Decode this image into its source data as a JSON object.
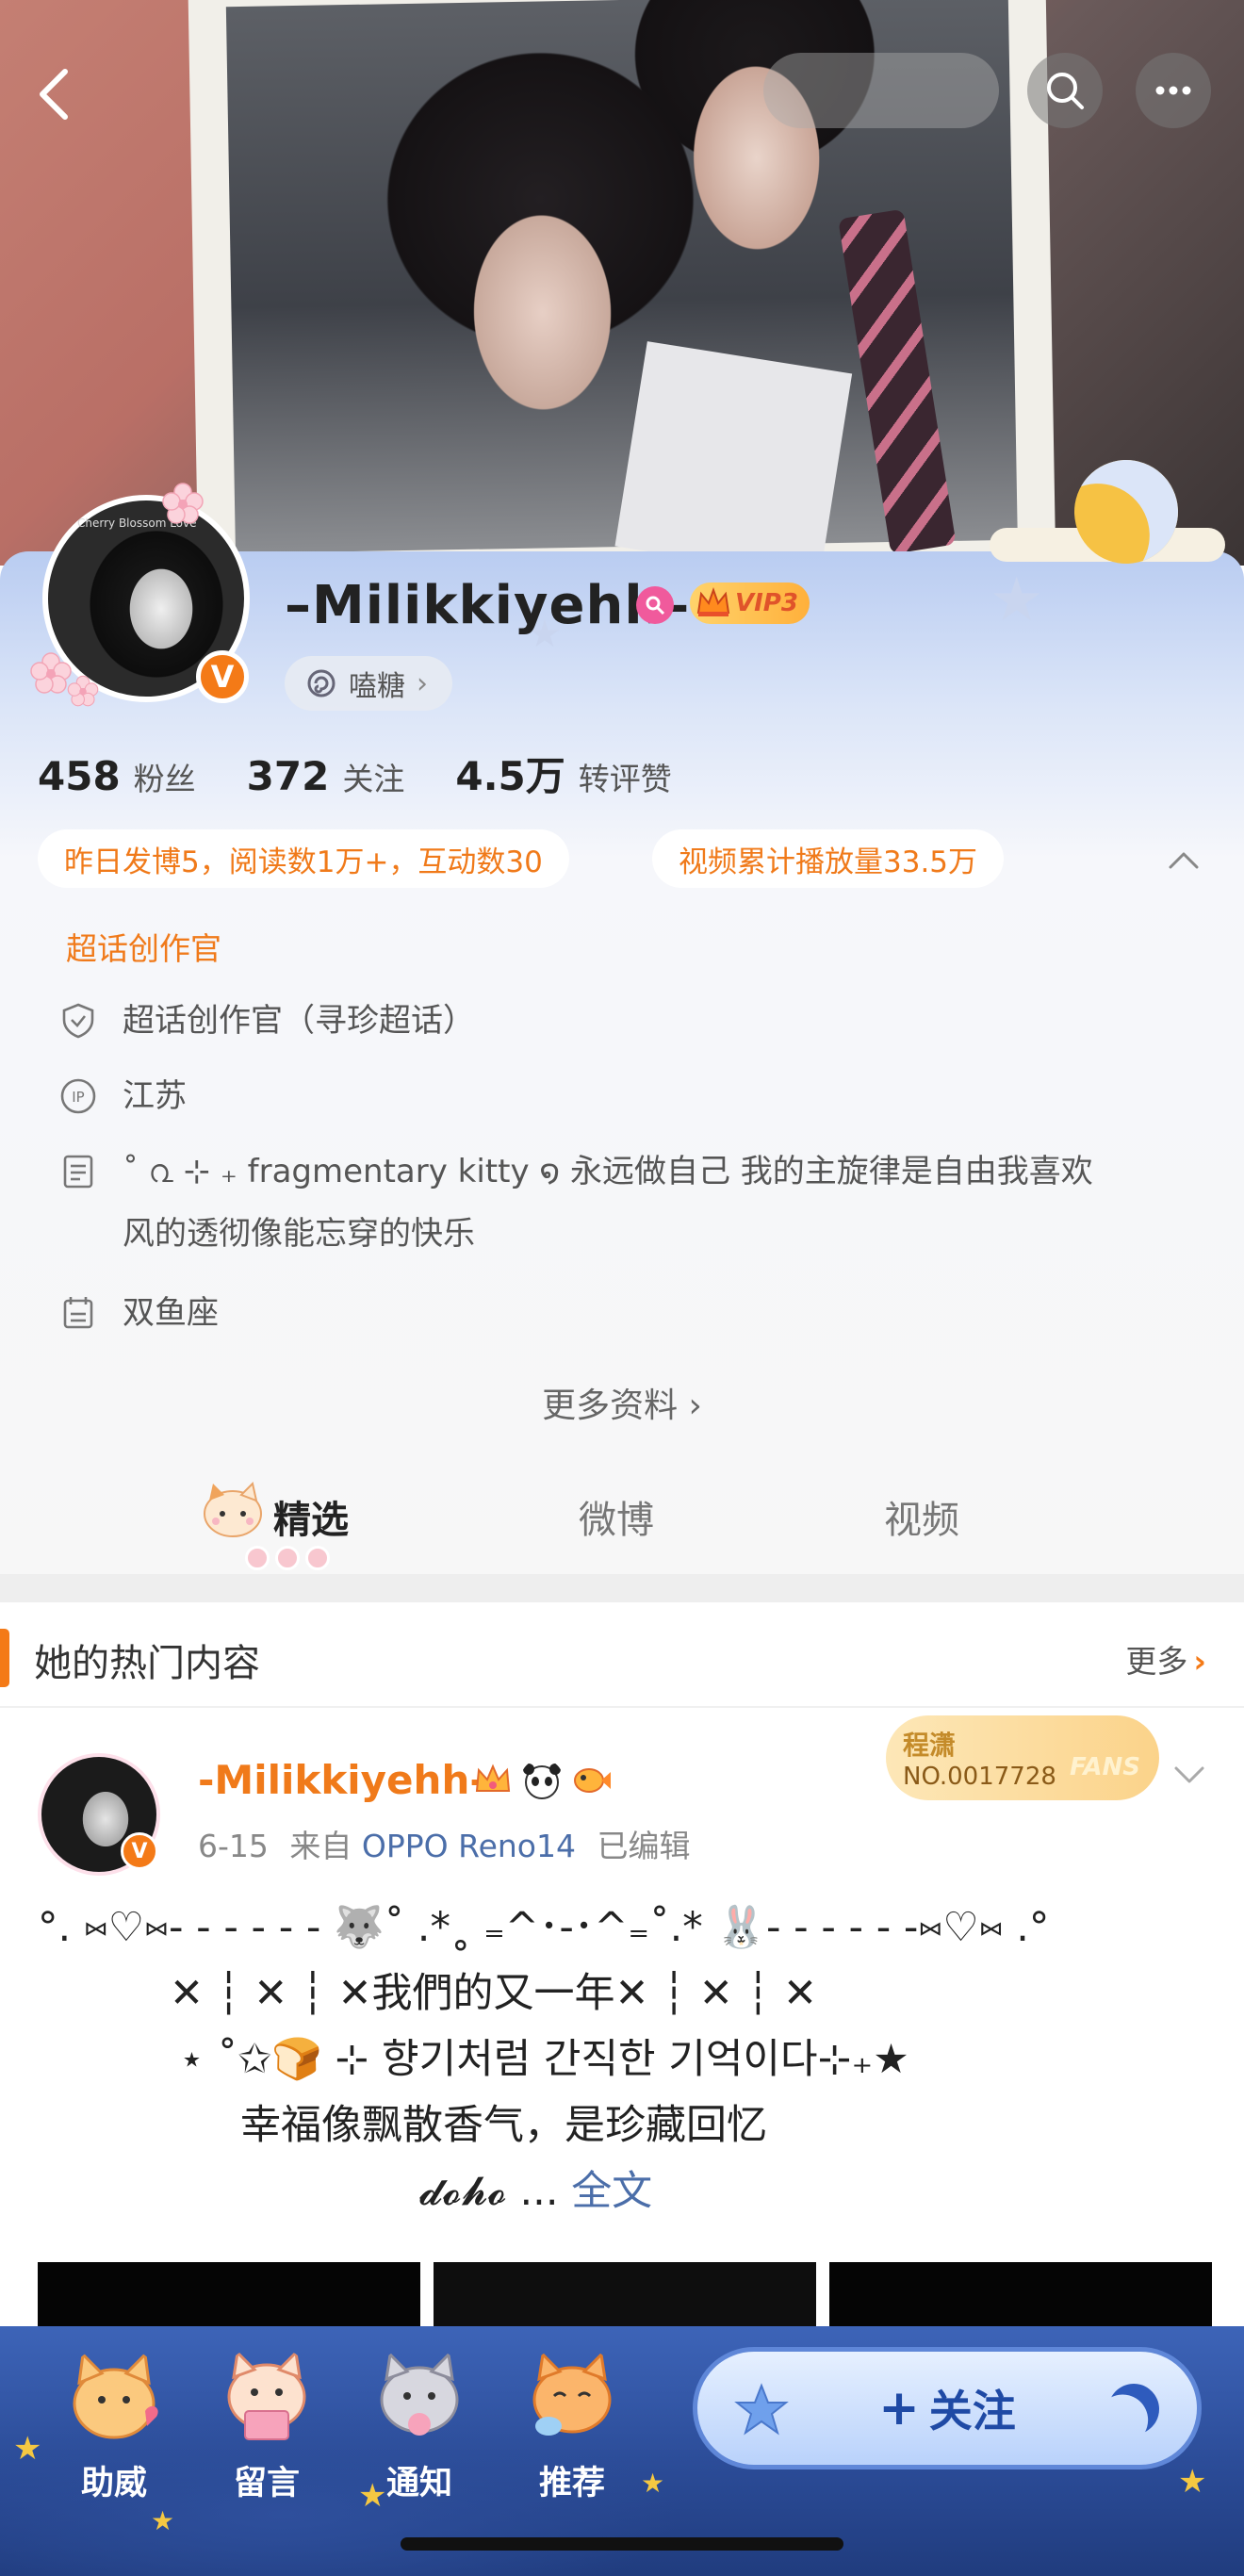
{
  "profile": {
    "username": "–Milikkiyehh–",
    "vip": "VIP3",
    "candy_label": "嗑糖",
    "avatar_caption": "Cherry Blossom Love"
  },
  "stats": [
    {
      "num": "458",
      "label": "粉丝"
    },
    {
      "num": "372",
      "label": "关注"
    },
    {
      "num": "4.5万",
      "label": "转评赞"
    }
  ],
  "chips": {
    "yesterday": "昨日发博5，阅读数1万+，互动数30",
    "video": "视频累计播放量33.5万"
  },
  "creator_title": "超话创作官",
  "info": {
    "creator": "超话创作官（寻珍超话）",
    "location": "江苏",
    "bio_line1": "˚ ൨ ⊹ ₊ fragmentary kitty ໑ 永远做自己 我的主旋律是自由我喜欢",
    "bio_line2": "风的透彻像能忘穿的快乐",
    "zodiac": "双鱼座"
  },
  "more_info": "更多资料 ›",
  "tabs": [
    "精选",
    "微博",
    "视频"
  ],
  "hot": {
    "title": "她的热门内容",
    "more": "更多"
  },
  "post": {
    "author": "-Milikkiyehh-",
    "date": "6-15",
    "from": "来自",
    "device": "OPPO Reno14",
    "edited": "已编辑",
    "badge_line1": "程潇",
    "badge_line2": "NO.0017728",
    "badge_fans": "FANS",
    "lines": [
      "°. ⑅♡⑅- - - - - - 🐺˚ .*˳ ₌^･-･^₌˚.* 🐰- - - - - -⑅♡⑅ .°",
      "✕ ┆ ✕ ┆ ✕我們的又一年✕ ┆ ✕ ┆ ✕",
      "⋆ ˚✩🍞 ⊹ 향기처럼 간직한 기억이다⊹₊★",
      "幸福像飘散香气，是珍藏回忆",
      "𝓭𝓸𝓱𝓸 ..."
    ],
    "full_text": "全文"
  },
  "bottom": {
    "items": [
      "助威",
      "留言",
      "通知",
      "推荐"
    ],
    "follow": "关注",
    "follow_plus": "+"
  },
  "colors": {
    "accent": "#f47a17",
    "link": "#4b6ea9",
    "bar_blue": "#2a4a95"
  }
}
